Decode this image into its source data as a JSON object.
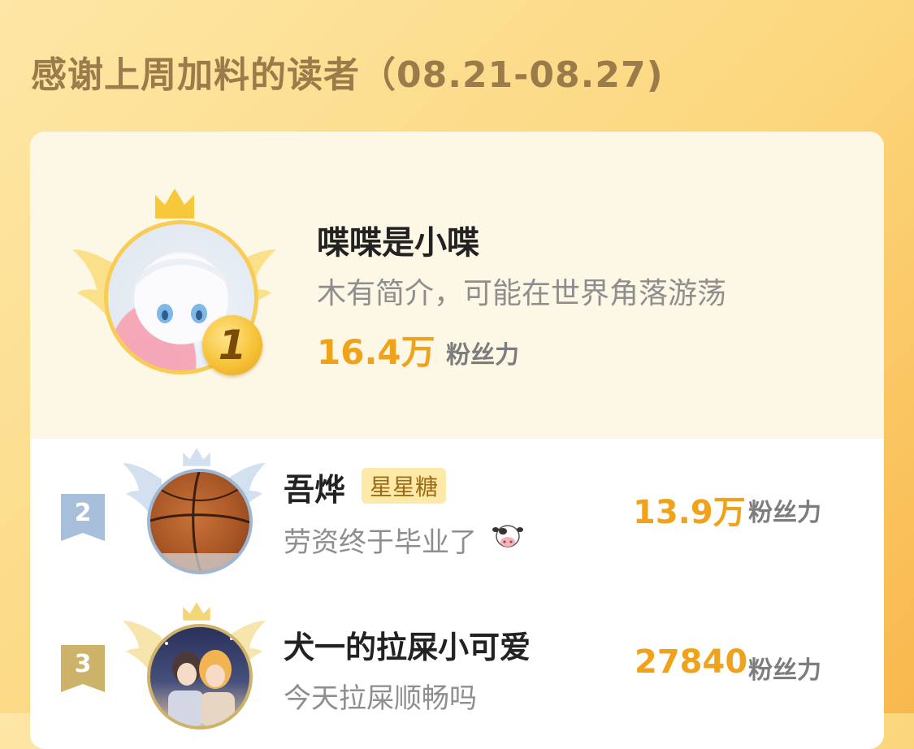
{
  "title": "感谢上周加料的读者（08.21-08.27)",
  "readers": [
    {
      "rank": "1",
      "name": "喋喋是小喋",
      "bio": "木有简介，可能在世界角落游荡",
      "score": "16.4万",
      "unit": "粉丝力"
    },
    {
      "rank": "2",
      "name": "吾烨",
      "tag": "星星糖",
      "bio": "劳资终于毕业了",
      "score": "13.9万",
      "unit": "粉丝力"
    },
    {
      "rank": "3",
      "name": "犬一的拉屎小可爱",
      "bio": "今天拉屎顺畅吗",
      "score": "27840",
      "unit": "粉丝力"
    }
  ],
  "colors": {
    "gold": "#f1a21b",
    "silver": "#9fb6d3",
    "bronze": "#cdb26a"
  },
  "icons": [
    "crown-icon",
    "wings-icon",
    "cow-emoji-icon",
    "rank-medal-icon"
  ]
}
